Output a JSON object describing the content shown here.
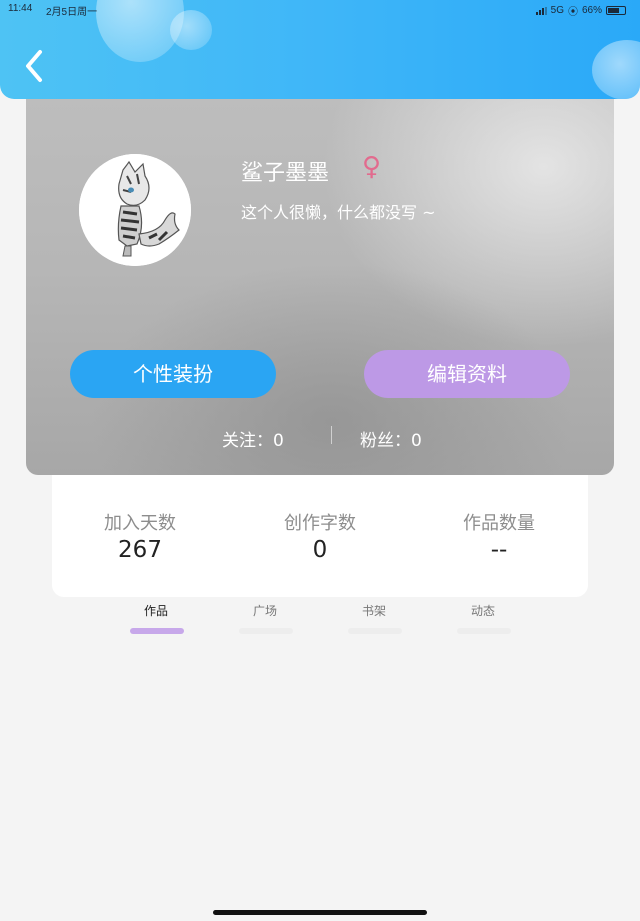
{
  "status_bar": {
    "time": "11:44",
    "date": "2月5日周一",
    "network": "5G",
    "battery": "66%"
  },
  "profile": {
    "name": "鲨子墨墨",
    "gender_symbol": "♀",
    "bio": "这个人很懒，什么都没写 ~"
  },
  "buttons": {
    "style": "个性装扮",
    "edit": "编辑资料"
  },
  "social": {
    "follow": "关注：0",
    "fans": "粉丝：0"
  },
  "stats": [
    {
      "label": "加入天数",
      "value": "267"
    },
    {
      "label": "创作字数",
      "value": "0"
    },
    {
      "label": "作品数量",
      "value": "--"
    }
  ],
  "tabs": [
    {
      "label": "作品",
      "active": true
    },
    {
      "label": "广场",
      "active": false
    },
    {
      "label": "书架",
      "active": false
    },
    {
      "label": "动态",
      "active": false
    }
  ],
  "colors": {
    "header_blue": "#3fb6f8",
    "style_button": "#2aa5f3",
    "edit_button": "#bd99e6",
    "gender_pink": "#e26b8e",
    "active_tab_indicator": "#c7a8ea"
  }
}
